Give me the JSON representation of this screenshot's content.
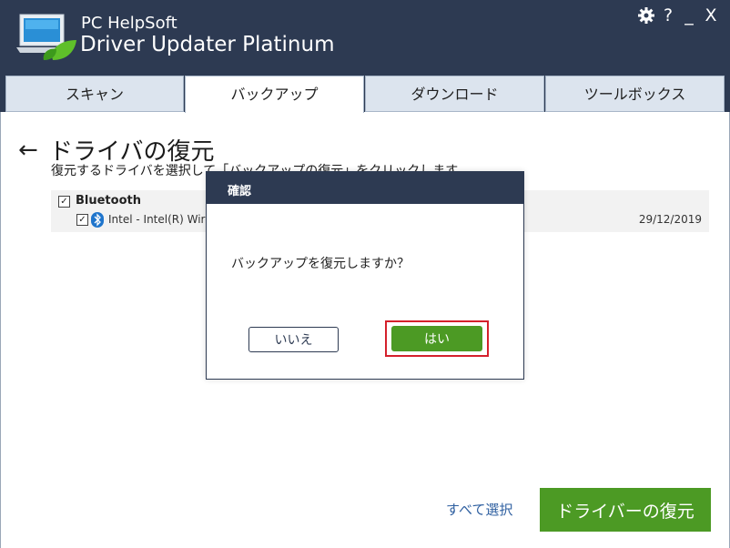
{
  "app": {
    "brand_line1": "PC HelpSoft",
    "brand_line2": "Driver Updater Platinum",
    "icons": [
      "laptop-leaf-logo",
      "gear-icon",
      "help-icon",
      "minimize-icon",
      "close-icon"
    ],
    "controls": {
      "help": "?",
      "minimize": "_",
      "close": "X"
    }
  },
  "tabs": [
    {
      "label": "スキャン",
      "active": false
    },
    {
      "label": "バックアップ",
      "active": true
    },
    {
      "label": "ダウンロード",
      "active": false
    },
    {
      "label": "ツールボックス",
      "active": false
    }
  ],
  "page": {
    "back_arrow": "←",
    "title": "ドライバの復元",
    "subtitle": "復元するドライバを選択して「バックアップの復元」をクリックします"
  },
  "drivers": {
    "category": {
      "label": "Bluetooth",
      "checked": true
    },
    "items": [
      {
        "name": "Intel - Intel(R) Wireless Bluetooth(R)",
        "date": "29/12/2019",
        "checked": true,
        "icon": "bluetooth-icon"
      }
    ]
  },
  "footer": {
    "select_all": "すべて選択",
    "restore_button": "ドライバーの復元"
  },
  "dialog": {
    "title": "確認",
    "message": "バックアップを復元しますか？",
    "no_button": "いいえ",
    "yes_button": "はい"
  },
  "colors": {
    "header_bg": "#2d3a52",
    "accent_green": "#4c9a24",
    "highlight_red": "#d4202c",
    "tab_bg": "#dce4ee"
  }
}
